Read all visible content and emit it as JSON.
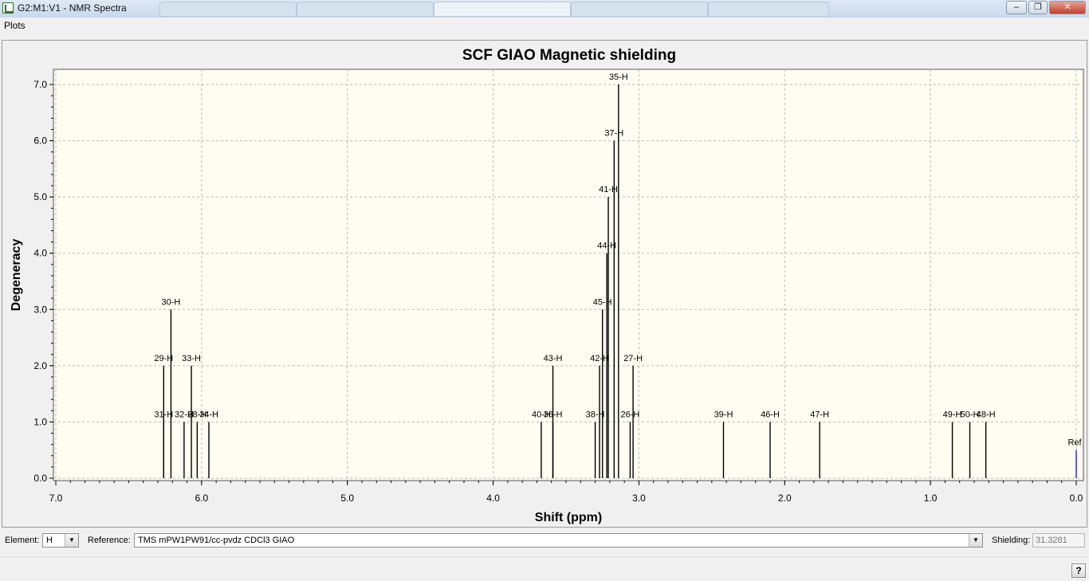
{
  "window": {
    "title": "G2:M1:V1 - NMR Spectra",
    "minimize_icon": "minimize-icon",
    "maximize_icon": "restore-icon",
    "close_icon": "close-icon"
  },
  "menu": {
    "plots": "Plots"
  },
  "chart_data": {
    "type": "bar",
    "title": "SCF GIAO Magnetic shielding",
    "xlabel": "Shift (ppm)",
    "ylabel": "Degeneracy",
    "xlim": [
      7.0,
      0.0
    ],
    "ylim": [
      0.0,
      7.0
    ],
    "x_reversed": true,
    "grid": true,
    "plot_background": "#fdfdf2",
    "line_color": "#000000",
    "ref_color": "#2020c0",
    "xticks": [
      "7.0",
      "6.0",
      "5.0",
      "4.0",
      "3.0",
      "2.0",
      "1.0",
      "0.0"
    ],
    "yticks": [
      "0.0",
      "1.0",
      "2.0",
      "3.0",
      "4.0",
      "5.0",
      "6.0",
      "7.0"
    ],
    "peaks": [
      {
        "label": "31-H",
        "x": 6.26,
        "y": 1
      },
      {
        "label": "29-H",
        "x": 6.26,
        "y": 2
      },
      {
        "label": "30-H",
        "x": 6.21,
        "y": 3
      },
      {
        "label": "32-H",
        "x": 6.12,
        "y": 1
      },
      {
        "label": "33-H",
        "x": 6.07,
        "y": 2
      },
      {
        "label": "28-H",
        "x": 6.03,
        "y": 1
      },
      {
        "label": "34-H",
        "x": 5.95,
        "y": 1
      },
      {
        "label": "40-H",
        "x": 3.67,
        "y": 1
      },
      {
        "label": "36-H",
        "x": 3.59,
        "y": 1
      },
      {
        "label": "43-H",
        "x": 3.59,
        "y": 2
      },
      {
        "label": "38-H",
        "x": 3.3,
        "y": 1
      },
      {
        "label": "42-H",
        "x": 3.27,
        "y": 2
      },
      {
        "label": "45-H",
        "x": 3.25,
        "y": 3
      },
      {
        "label": "44-H",
        "x": 3.22,
        "y": 4
      },
      {
        "label": "41-H",
        "x": 3.21,
        "y": 5
      },
      {
        "label": "37-H",
        "x": 3.17,
        "y": 6
      },
      {
        "label": "35-H",
        "x": 3.14,
        "y": 7
      },
      {
        "label": "26-H",
        "x": 3.06,
        "y": 1
      },
      {
        "label": "27-H",
        "x": 3.04,
        "y": 2
      },
      {
        "label": "39-H",
        "x": 2.42,
        "y": 1
      },
      {
        "label": "46-H",
        "x": 2.1,
        "y": 1
      },
      {
        "label": "47-H",
        "x": 1.76,
        "y": 1
      },
      {
        "label": "49-H",
        "x": 0.85,
        "y": 1
      },
      {
        "label": "50-H",
        "x": 0.73,
        "y": 1
      },
      {
        "label": "48-H",
        "x": 0.62,
        "y": 1
      },
      {
        "label": "Ref",
        "x": 0.0,
        "y": 0.5,
        "ref": true
      }
    ]
  },
  "controls": {
    "element_label": "Element:",
    "element_value": "H",
    "reference_label": "Reference:",
    "reference_value": "TMS mPW1PW91/cc-pvdz CDCl3 GIAO",
    "shielding_label": "Shielding:",
    "shielding_value": "31.3281",
    "dropdown_icon": "chevron-down-icon"
  },
  "status": {
    "help_label": "?"
  }
}
